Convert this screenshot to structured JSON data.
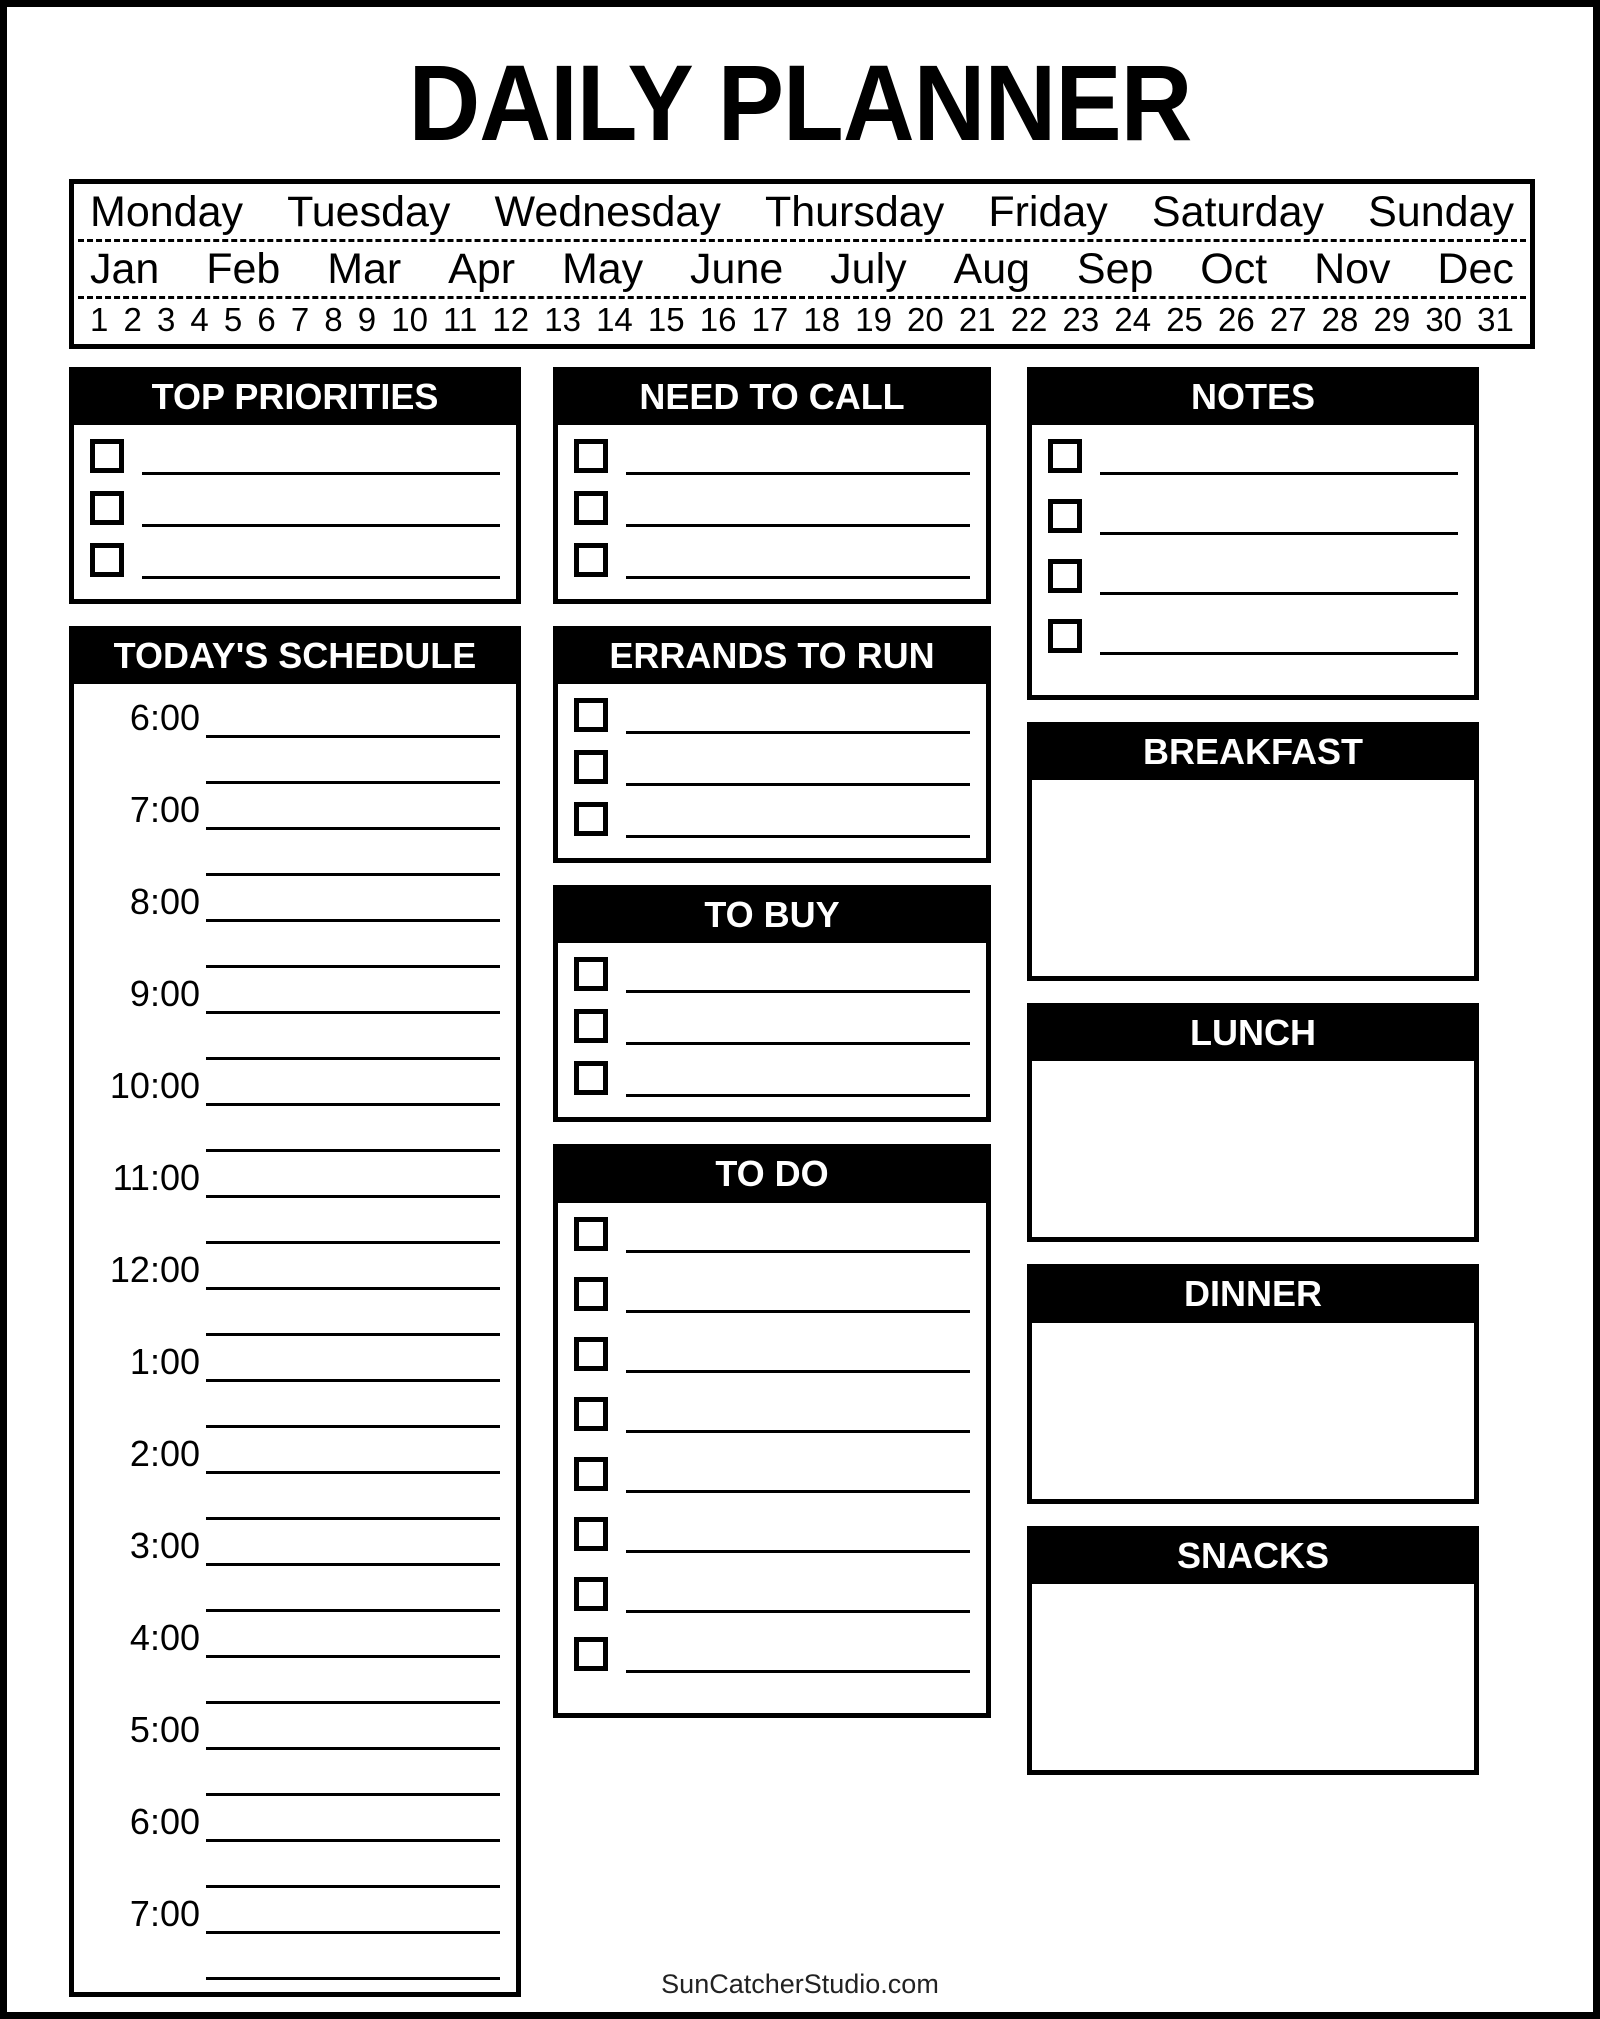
{
  "title": "DAILY PLANNER",
  "date_header": {
    "days": [
      "Monday",
      "Tuesday",
      "Wednesday",
      "Thursday",
      "Friday",
      "Saturday",
      "Sunday"
    ],
    "months": [
      "Jan",
      "Feb",
      "Mar",
      "Apr",
      "May",
      "June",
      "July",
      "Aug",
      "Sep",
      "Oct",
      "Nov",
      "Dec"
    ],
    "days_of_month": [
      "1",
      "2",
      "3",
      "4",
      "5",
      "6",
      "7",
      "8",
      "9",
      "10",
      "11",
      "12",
      "13",
      "14",
      "15",
      "16",
      "17",
      "18",
      "19",
      "20",
      "21",
      "22",
      "23",
      "24",
      "25",
      "26",
      "27",
      "28",
      "29",
      "30",
      "31"
    ]
  },
  "sections": {
    "top_priorities": {
      "title": "TOP PRIORITIES",
      "rows": 3
    },
    "todays_schedule": {
      "title": "TODAY'S SCHEDULE",
      "times": [
        "6:00",
        "7:00",
        "8:00",
        "9:00",
        "10:00",
        "11:00",
        "12:00",
        "1:00",
        "2:00",
        "3:00",
        "4:00",
        "5:00",
        "6:00",
        "7:00"
      ]
    },
    "need_to_call": {
      "title": "NEED TO CALL",
      "rows": 3
    },
    "errands_to_run": {
      "title": "ERRANDS TO RUN",
      "rows": 3
    },
    "to_buy": {
      "title": "TO BUY",
      "rows": 3
    },
    "to_do": {
      "title": "TO DO",
      "rows": 8
    },
    "notes": {
      "title": "NOTES",
      "rows": 4
    },
    "breakfast": {
      "title": "BREAKFAST"
    },
    "lunch": {
      "title": "LUNCH"
    },
    "dinner": {
      "title": "DINNER"
    },
    "snacks": {
      "title": "SNACKS"
    }
  },
  "footer": "SunCatcherStudio.com",
  "colors": {
    "ink": "#000000",
    "paper": "#ffffff"
  }
}
